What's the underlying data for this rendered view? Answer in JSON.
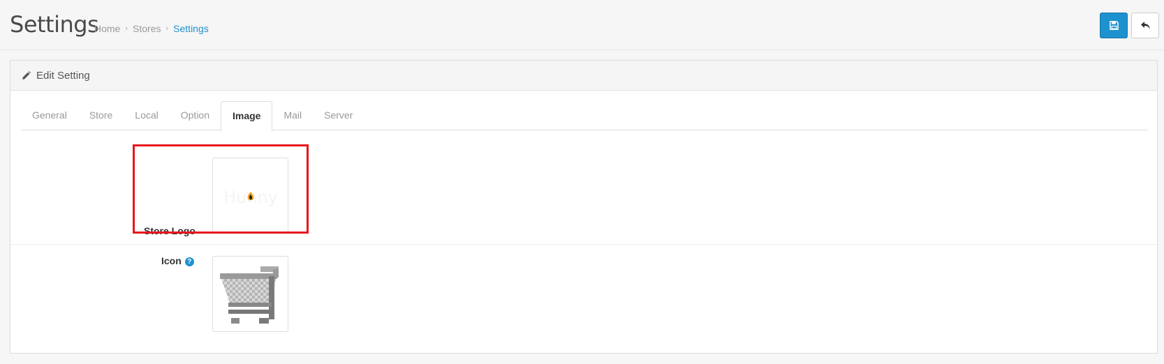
{
  "header": {
    "title": "Settings",
    "breadcrumb": [
      "Home",
      "Stores",
      "Settings"
    ],
    "separator": "›"
  },
  "actions": {
    "save_icon": "save-icon",
    "back_icon": "reply-icon"
  },
  "panel": {
    "heading_icon": "pencil-icon",
    "heading": "Edit Setting"
  },
  "tabs": [
    {
      "label": "General"
    },
    {
      "label": "Store"
    },
    {
      "label": "Local"
    },
    {
      "label": "Option"
    },
    {
      "label": "Image",
      "active": true
    },
    {
      "label": "Mail"
    },
    {
      "label": "Server"
    }
  ],
  "fields": {
    "store_logo_label": "Store Logo",
    "icon_label": "Icon",
    "help_glyph": "?"
  },
  "colors": {
    "primary": "#1e91cf",
    "highlight": "#e8151b"
  }
}
